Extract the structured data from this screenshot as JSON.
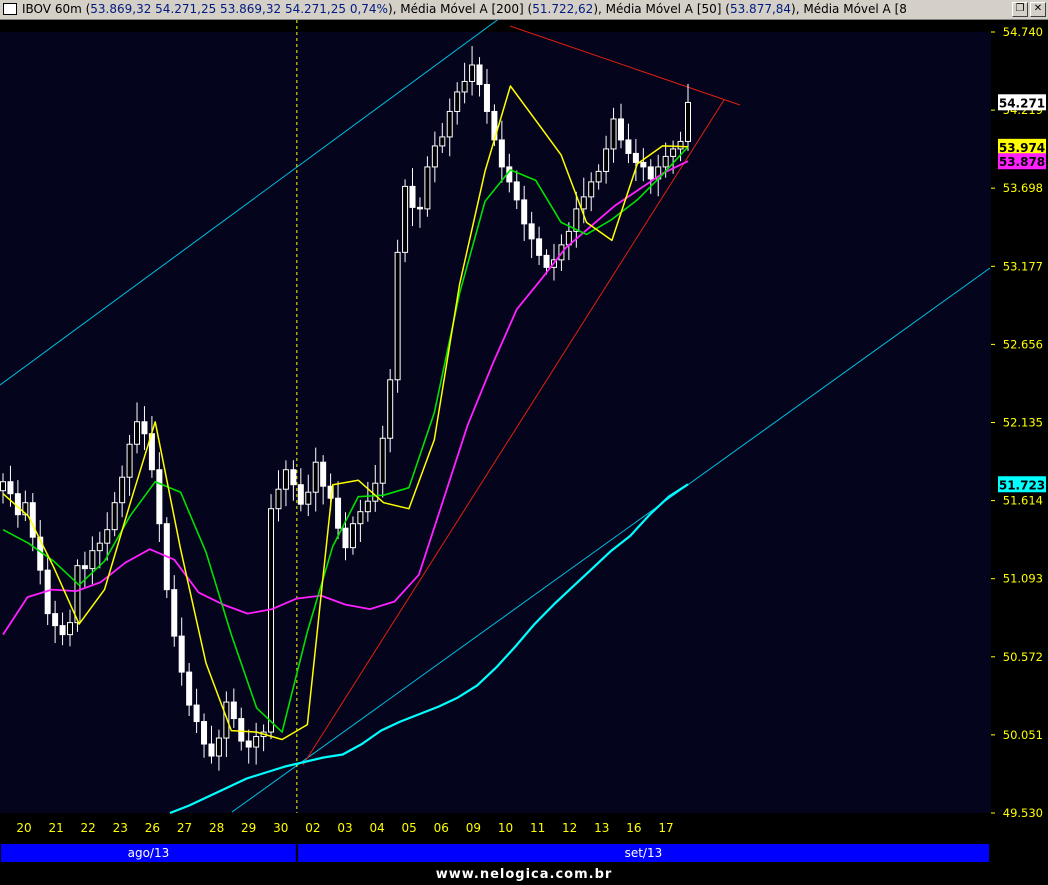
{
  "window": {
    "title_prefix": "IBOV 60m (",
    "ohlc": "53.869,32  54.271,25  53.869,32  54.271,25  0,74%",
    "ma200_label": "), Média Móvel A [200] (",
    "ma200_value": "51.722,62",
    "ma50_label": "), Média Móvel A [50] (",
    "ma50_value": "53.877,84",
    "ma_extra_label": "), Média Móvel A [8"
  },
  "colors": {
    "background": "#000000",
    "plot_background": "#04041c",
    "axis_text": "#ffff00",
    "period_band": "#0000ff",
    "candle": "#ffffff",
    "ma_fast": "#ffff00",
    "ma_mid": "#00e000",
    "ma50": "#ff20ff",
    "ma200": "#00ffff",
    "channel": "#00c0e0",
    "triangle": "#e02010",
    "vline": "#ffff00"
  },
  "chart_data": {
    "type": "candlestick",
    "ylim": [
      49530,
      54740
    ],
    "y_ticks": [
      "54.740",
      "54.219",
      "53.698",
      "53.177",
      "52.656",
      "52.135",
      "51.614",
      "51.093",
      "50.572",
      "50.051",
      "49.530"
    ],
    "x_ticks": [
      "20",
      "21",
      "22",
      "23",
      "26",
      "27",
      "28",
      "29",
      "30",
      "02",
      "03",
      "04",
      "05",
      "06",
      "09",
      "10",
      "11",
      "12",
      "13",
      "16",
      "17"
    ],
    "periods": [
      "ago/13",
      "set/13"
    ],
    "price_labels": [
      {
        "text": "54.271",
        "value": 54271,
        "color": "#ffffff"
      },
      {
        "text": "53.974",
        "value": 53974,
        "color": "#ffff00"
      },
      {
        "text": "53.878",
        "value": 53878,
        "color": "#ff20ff"
      },
      {
        "text": "51.723",
        "value": 51723,
        "color": "#00ffff"
      }
    ],
    "series": [
      {
        "name": "IBOV 60m",
        "role": "price",
        "values": [
          51740,
          51660,
          51520,
          51600,
          51370,
          51150,
          50860,
          50780,
          50720,
          50800,
          51180,
          51160,
          51280,
          51330,
          51420,
          51600,
          51770,
          51990,
          52140,
          52060,
          51820,
          51460,
          51020,
          50710,
          50470,
          50250,
          50140,
          49990,
          49910,
          50030,
          50270,
          50160,
          50010,
          49970,
          50040,
          50070,
          51560,
          51690,
          51820,
          51720,
          51590,
          51670,
          51870,
          51710,
          51630,
          51430,
          51300,
          51460,
          51540,
          51610,
          51730,
          52030,
          52420,
          53270,
          53710,
          53570,
          53560,
          53840,
          53980,
          54040,
          54210,
          54340,
          54410,
          54520,
          54390,
          54210,
          54020,
          53840,
          53740,
          53620,
          53460,
          53360,
          53250,
          53170,
          53220,
          53320,
          53410,
          53560,
          53640,
          53740,
          53810,
          53960,
          54160,
          54020,
          53930,
          53870,
          53840,
          53760,
          53840,
          53910,
          53960,
          54010,
          54270
        ]
      },
      {
        "name": "Média Móvel A [200]",
        "role": "ma200",
        "values": [
          49530,
          49580,
          49640,
          49700,
          49760,
          49800,
          49840,
          49870,
          49900,
          49920,
          49990,
          50080,
          50140,
          50190,
          50240,
          50300,
          50380,
          50500,
          50640,
          50790,
          50920,
          51040,
          51160,
          51280,
          51380,
          51520,
          51640,
          51723
        ]
      },
      {
        "name": "Média Móvel A [50]",
        "role": "ma50",
        "values": [
          50720,
          50970,
          51020,
          51010,
          51070,
          51200,
          51290,
          51220,
          51000,
          50920,
          50860,
          50890,
          50960,
          50980,
          50920,
          50890,
          50940,
          51120,
          51620,
          52120,
          52520,
          52890,
          53090,
          53300,
          53440,
          53580,
          53690,
          53800,
          53878
        ]
      },
      {
        "role": "ma_mid",
        "values": [
          51420,
          51330,
          51210,
          51050,
          51210,
          51510,
          51740,
          51670,
          51270,
          50720,
          50230,
          50070,
          50740,
          51310,
          51640,
          51650,
          51700,
          52200,
          53000,
          53610,
          53820,
          53750,
          53470,
          53390,
          53490,
          53620,
          53790,
          53974
        ]
      },
      {
        "role": "ma_fast",
        "values": [
          51660,
          51510,
          51170,
          50790,
          51020,
          51590,
          52140,
          51290,
          50530,
          50080,
          50070,
          50020,
          50120,
          51720,
          51750,
          51600,
          51560,
          52020,
          53060,
          53810,
          54380,
          54150,
          53920,
          53470,
          53350,
          53860,
          53980,
          53974
        ]
      }
    ]
  },
  "footer": {
    "site": "www.nelogica.com.br"
  }
}
